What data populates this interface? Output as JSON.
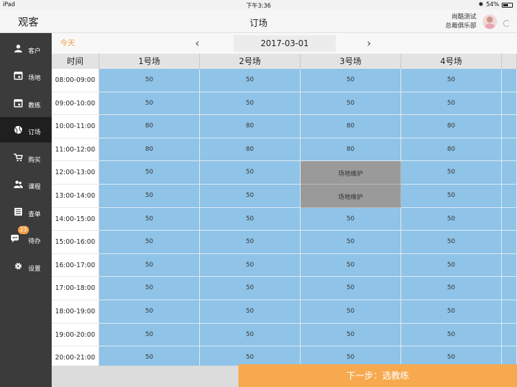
{
  "statusbar": {
    "device": "iPad",
    "time": "下午3:36",
    "battery": "54%"
  },
  "header": {
    "brand": "观客",
    "title": "订场",
    "user_name": "尚酷测试",
    "club": "总裁俱乐部"
  },
  "sidebar": {
    "items": [
      {
        "label": "客户",
        "icon": "person-icon"
      },
      {
        "label": "场地",
        "icon": "calendar-icon"
      },
      {
        "label": "教练",
        "icon": "calendar-icon"
      },
      {
        "label": "订场",
        "icon": "ball-icon",
        "active": true
      },
      {
        "label": "购买",
        "icon": "cart-icon"
      },
      {
        "label": "课程",
        "icon": "people-icon"
      },
      {
        "label": "查单",
        "icon": "list-icon"
      },
      {
        "label": "待办",
        "icon": "chat-icon",
        "badge": "23"
      },
      {
        "label": "设置",
        "icon": "gear-icon"
      }
    ]
  },
  "datebar": {
    "today": "今天",
    "date": "2017-03-01",
    "prev": "‹",
    "next": "›"
  },
  "grid": {
    "time_header": "时间",
    "courts": [
      "1号场",
      "2号场",
      "3号场",
      "4号场"
    ],
    "rows": [
      {
        "time": "08:00-09:00",
        "cells": [
          "50",
          "50",
          "50",
          "50"
        ]
      },
      {
        "time": "09:00-10:00",
        "cells": [
          "50",
          "50",
          "50",
          "50"
        ]
      },
      {
        "time": "10:00-11:00",
        "cells": [
          "80",
          "80",
          "80",
          "80"
        ]
      },
      {
        "time": "11:00-12:00",
        "cells": [
          "80",
          "80",
          "80",
          "80"
        ]
      },
      {
        "time": "12:00-13:00",
        "cells": [
          "50",
          "50",
          "场地维护",
          "50"
        ]
      },
      {
        "time": "13:00-14:00",
        "cells": [
          "50",
          "50",
          "场地维护",
          "50"
        ]
      },
      {
        "time": "14:00-15:00",
        "cells": [
          "50",
          "50",
          "50",
          "50"
        ]
      },
      {
        "time": "15:00-16:00",
        "cells": [
          "50",
          "50",
          "50",
          "50"
        ]
      },
      {
        "time": "16:00-17:00",
        "cells": [
          "50",
          "50",
          "50",
          "50"
        ]
      },
      {
        "time": "17:00-18:00",
        "cells": [
          "50",
          "50",
          "50",
          "50"
        ]
      },
      {
        "time": "18:00-19:00",
        "cells": [
          "50",
          "50",
          "50",
          "50"
        ]
      },
      {
        "time": "19:00-20:00",
        "cells": [
          "50",
          "50",
          "50",
          "50"
        ]
      },
      {
        "time": "20:00-21:00",
        "cells": [
          "50",
          "50",
          "50",
          "50"
        ]
      }
    ],
    "maintenance_label": "场地维护"
  },
  "footer": {
    "next_button": "下一步：选教练"
  },
  "colors": {
    "slot_available": "#8fc3e7",
    "slot_maintenance": "#9a9a9a",
    "accent": "#f6a94f",
    "sidebar": "#3b3b3b"
  }
}
